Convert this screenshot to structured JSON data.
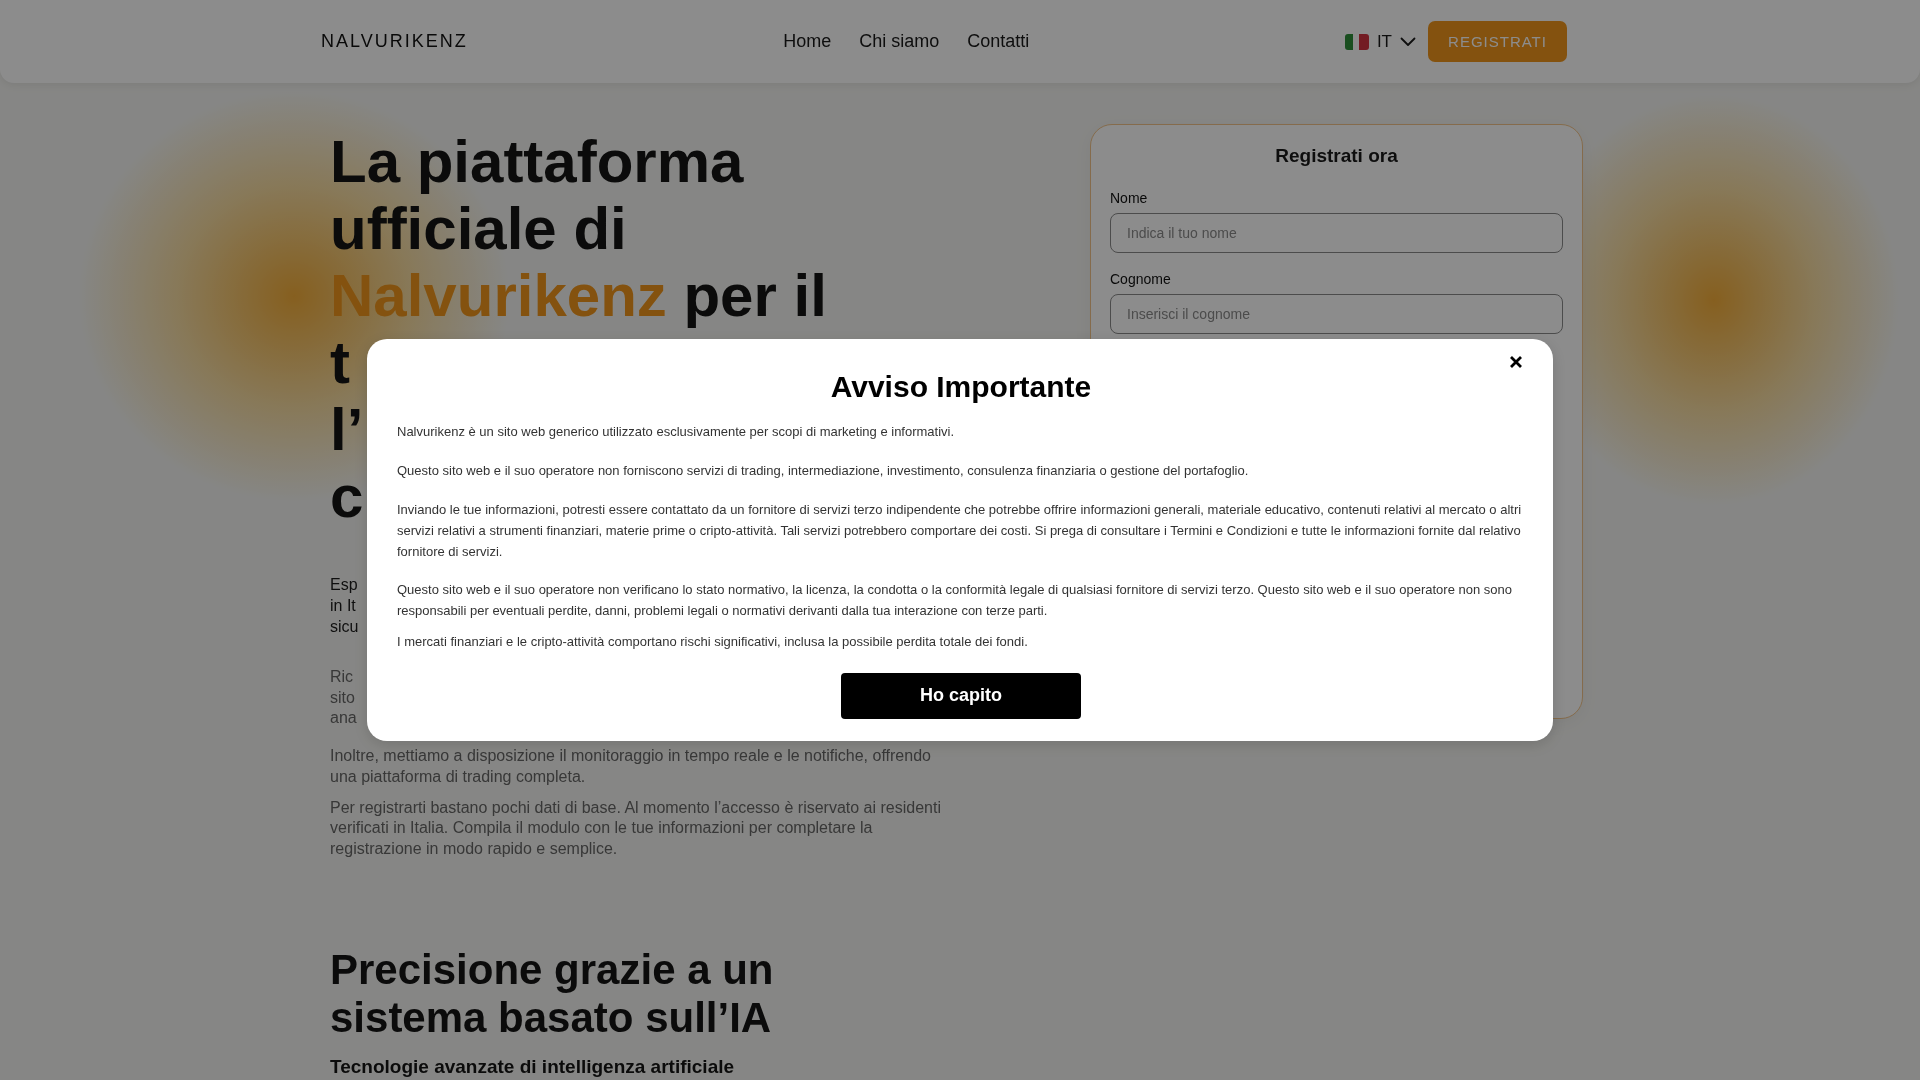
{
  "header": {
    "logo": "NALVURIKENZ",
    "nav": [
      "Home",
      "Chi siamo",
      "Contatti"
    ],
    "language": "IT",
    "cta": "REGISTRATI"
  },
  "hero": {
    "title_lines": [
      [
        {
          "text": "La piattaforma",
          "accent": false
        }
      ],
      [
        {
          "text": "ufficiale di",
          "accent": false
        }
      ],
      [
        {
          "text": "Nalvurikenz",
          "accent": true
        },
        {
          "text": "per il",
          "accent": false
        }
      ],
      [
        {
          "text": "t",
          "accent": false
        }
      ],
      [
        {
          "text": "l’",
          "accent": false
        }
      ],
      [
        {
          "text": "c",
          "accent": false
        }
      ]
    ],
    "lead_lines": [
      "Esp",
      "in It",
      "sicu"
    ],
    "body_lines": [
      "Ric",
      "sito",
      "ana"
    ],
    "paragraphs": [
      "Inoltre, mettiamo a disposizione il monitoraggio in tempo reale e le notifiche, offrendo una piattaforma di trading completa.",
      "Per registrarti bastano pochi dati di base. Al momento l’accesso è riservato ai residenti verificati in Italia. Compila il modulo con le tue informazioni per completare la registrazione in modo rapido e semplice."
    ]
  },
  "signup_form": {
    "title": "Registrati ora",
    "fields": [
      {
        "label": "Nome",
        "placeholder": "Indica il tuo nome"
      },
      {
        "label": "Cognome",
        "placeholder": "Inserisci il cognome"
      }
    ]
  },
  "features": {
    "title": "Precisione grazie a un sistema basato sull’IA",
    "subtitle": "Tecnologie avanzate di intelligenza artificiale"
  },
  "notice_dialog": {
    "title": "Avviso Importante",
    "paragraphs": [
      "Nalvurikenz è un sito web generico utilizzato esclusivamente per scopi di marketing e informativi.",
      "Questo sito web e il suo operatore non forniscono servizi di trading, intermediazione, investimento, consulenza finanziaria o gestione del portafoglio.",
      "Inviando le tue informazioni, potresti essere contattato da un fornitore di servizi terzo indipendente che potrebbe offrire informazioni generali, materiale educativo, contenuti relativi al mercato o altri servizi relativi a strumenti finanziari, materie prime o cripto-attività. Tali servizi potrebbero comportare dei costi. Si prega di consultare i Termini e Condizioni e tutte le informazioni fornite dal relativo fornitore di servizi.",
      "Questo sito web e il suo operatore non verificano lo stato normativo, la licenza, la condotta o la conformità legale di qualsiasi fornitore di servizi terzo. Questo sito web e il suo operatore non sono responsabili per eventuali perdite, danni, problemi legali o normativi derivanti dalla tua interazione con terze parti.",
      "I mercati finanziari e le cripto-attività comportano rischi significativi, inclusa la possibile perdita totale dei fondi."
    ],
    "button": "Ho capito"
  }
}
